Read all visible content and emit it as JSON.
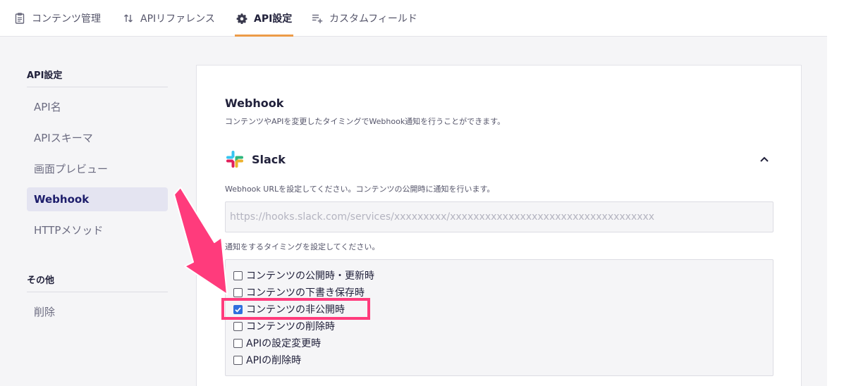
{
  "tabs": [
    {
      "label": "コンテンツ管理",
      "icon": "document-icon"
    },
    {
      "label": "APIリファレンス",
      "icon": "sort-arrows-icon"
    },
    {
      "label": "API設定",
      "icon": "gear-icon"
    },
    {
      "label": "カスタムフィールド",
      "icon": "list-add-icon"
    }
  ],
  "active_tab": "API設定",
  "sidebar": {
    "section1_heading": "API設定",
    "items": [
      {
        "label": "API名"
      },
      {
        "label": "APIスキーマ"
      },
      {
        "label": "画面プレビュー"
      },
      {
        "label": "Webhook"
      },
      {
        "label": "HTTPメソッド"
      }
    ],
    "active_item": "Webhook",
    "section2_heading": "その他",
    "other_items": [
      {
        "label": "削除"
      }
    ]
  },
  "main": {
    "webhook_title": "Webhook",
    "webhook_description": "コンテンツやAPIを変更したタイミングでWebhook通知を行うことができます。",
    "slack_label": "Slack",
    "url_help": "Webhook URLを設定してください。コンテンツの公開時に通知を行います。",
    "url_placeholder": "https://hooks.slack.com/services/xxxxxxxxx/xxxxxxxxxxxxxxxxxxxxxxxxxxxxxxxxxxx",
    "url_value": "",
    "timing_help": "通知をするタイミングを設定してください。",
    "checkboxes": [
      {
        "label": "コンテンツの公開時・更新時",
        "checked": false
      },
      {
        "label": "コンテンツの下書き保存時",
        "checked": false
      },
      {
        "label": "コンテンツの非公開時",
        "checked": true
      },
      {
        "label": "コンテンツの削除時",
        "checked": false
      },
      {
        "label": "APIの設定変更時",
        "checked": false
      },
      {
        "label": "APIの削除時",
        "checked": false
      }
    ]
  },
  "colors": {
    "accent_tab_underline": "#ec9b48",
    "sidebar_active_bg": "#e4e4f1",
    "annotation": "#ff3b7c",
    "checkbox_checked": "#2f6fde"
  }
}
